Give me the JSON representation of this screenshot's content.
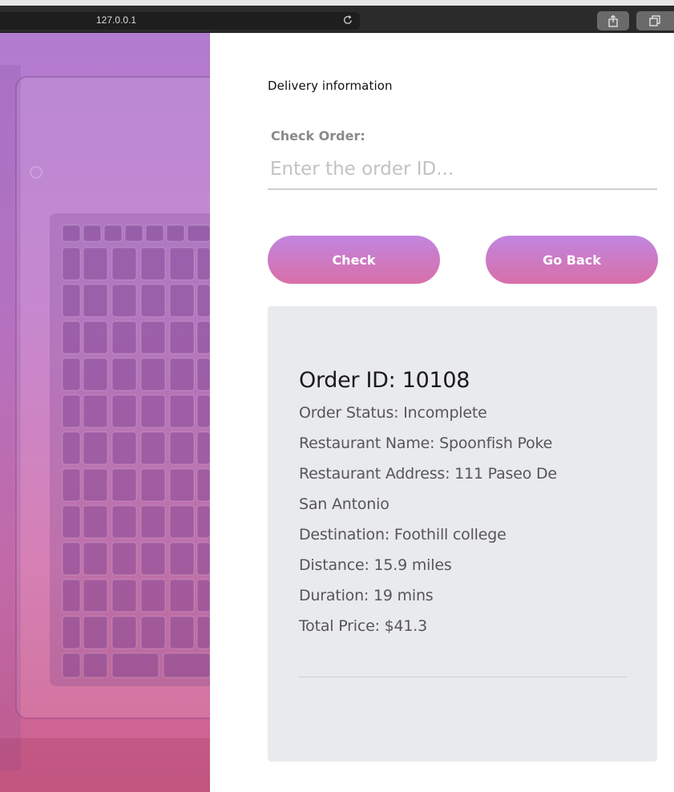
{
  "browser": {
    "url": "127.0.0.1"
  },
  "page": {
    "section_heading": "Delivery information",
    "check_label": "Check Order:",
    "order_input": {
      "value": "",
      "placeholder": "Enter the order ID..."
    },
    "check_button": "Check",
    "back_button": "Go Back"
  },
  "order": {
    "id_line": "Order ID: 10108",
    "status": "Order Status: Incomplete",
    "restaurant_name": "Restaurant Name: Spoonfish Poke",
    "restaurant_address_line1": "Restaurant Address: 111 Paseo De",
    "restaurant_address_line2": "San Antonio",
    "destination": "Destination: Foothill college",
    "distance": "Distance: 15.9 miles",
    "duration": "Duration: 19 mins",
    "total_price": "Total Price: $41.3"
  },
  "colors": {
    "button_gradient_top": "#c185e0",
    "button_gradient_bottom": "#d86fa8",
    "card_background": "#e9eaee",
    "side_panel_top": "#b27bd0",
    "side_panel_bottom": "#cc5f8b"
  },
  "icons": {
    "reload": "reload-icon",
    "share": "share-icon",
    "tabs": "tabs-icon"
  }
}
